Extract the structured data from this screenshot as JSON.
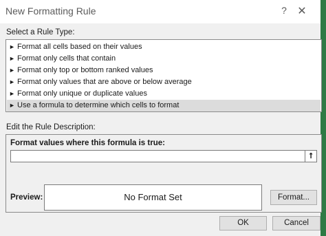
{
  "dialog": {
    "title": "New Formatting Rule",
    "help": "?",
    "close": "✕"
  },
  "rule_type": {
    "label": "Select a Rule Type:",
    "items": [
      {
        "label": "Format all cells based on their values",
        "selected": false
      },
      {
        "label": "Format only cells that contain",
        "selected": false
      },
      {
        "label": "Format only top or bottom ranked values",
        "selected": false
      },
      {
        "label": "Format only values that are above or below average",
        "selected": false
      },
      {
        "label": "Format only unique or duplicate values",
        "selected": false
      },
      {
        "label": "Use a formula to determine which cells to format",
        "selected": true
      }
    ],
    "bullet_glyph": "►"
  },
  "description": {
    "label": "Edit the Rule Description:",
    "formula_label": "Format values where this formula is true:",
    "formula_value": "",
    "collapse_glyph": "⭡",
    "preview_label": "Preview:",
    "preview_text": "No Format Set",
    "format_button": "Format..."
  },
  "buttons": {
    "ok": "OK",
    "cancel": "Cancel"
  },
  "colors": {
    "accent_edge": "#2f7a45",
    "selected_row": "#dcdcdc"
  }
}
